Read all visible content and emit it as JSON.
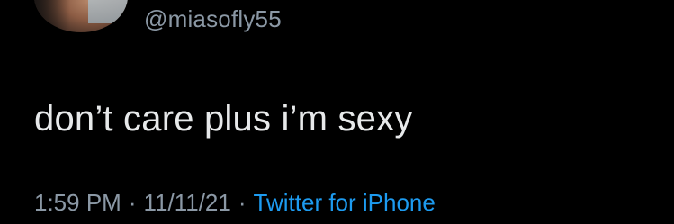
{
  "user": {
    "handle": "@miasofly55"
  },
  "tweet": {
    "text": "don’t care plus i’m sexy"
  },
  "meta": {
    "time": "1:59 PM",
    "separator": "·",
    "date": "11/11/21",
    "source": "Twitter for iPhone"
  },
  "colors": {
    "background": "#000000",
    "text": "#e7e9ea",
    "secondary": "#8b98a5",
    "link": "#1d9bf0"
  }
}
